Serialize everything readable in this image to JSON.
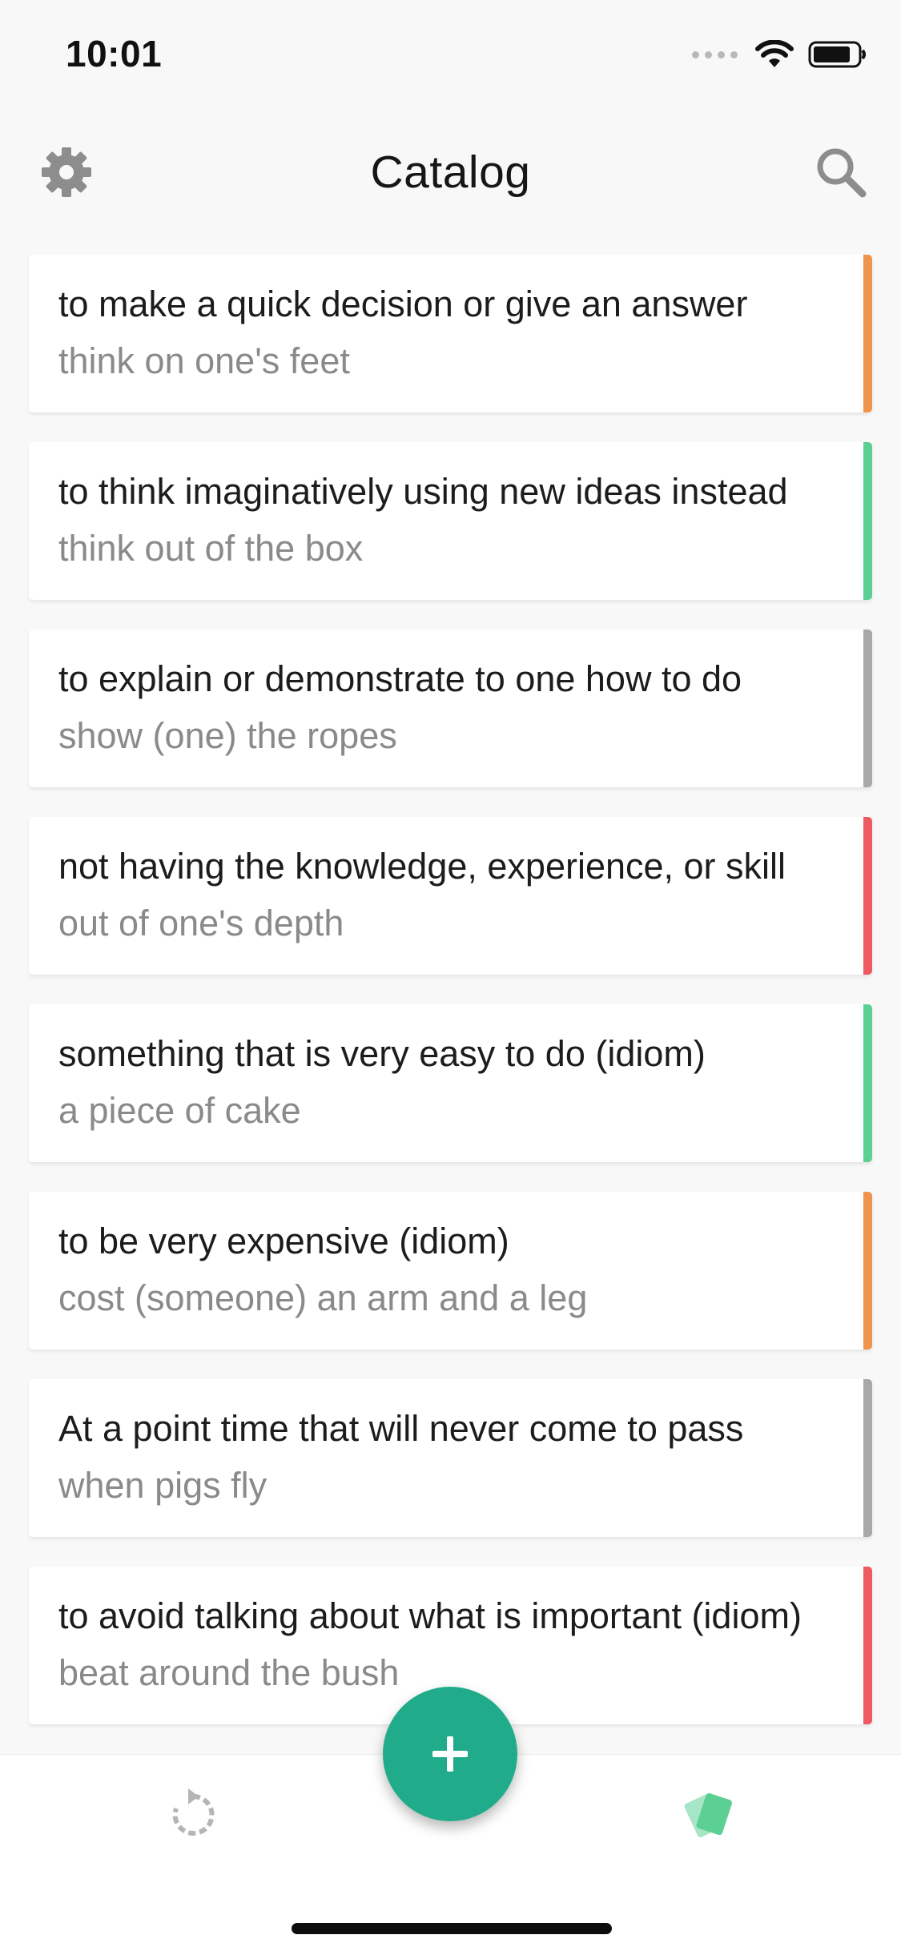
{
  "status_bar": {
    "time": "10:01"
  },
  "header": {
    "title": "Catalog",
    "settings_icon": "gear-icon",
    "search_icon": "search-icon"
  },
  "cards": [
    {
      "definition": "to make a quick decision or give an answer",
      "phrase": "think on one's feet",
      "accent": "#f0934d"
    },
    {
      "definition": "to think imaginatively using new ideas instead",
      "phrase": "think out of the box",
      "accent": "#5ccf93"
    },
    {
      "definition": "to explain or demonstrate to one how to do",
      "phrase": "show (one) the ropes",
      "accent": "#a8a8a8"
    },
    {
      "definition": "not having the knowledge, experience, or skill",
      "phrase": "out of one's depth",
      "accent": "#ee5a63"
    },
    {
      "definition": "something that is very easy to do (idiom)",
      "phrase": "a piece of cake",
      "accent": "#5ccf93"
    },
    {
      "definition": "to be very expensive (idiom)",
      "phrase": "cost (someone) an arm and a leg",
      "accent": "#f0934d"
    },
    {
      "definition": "At a point time that will never come to pass",
      "phrase": "when pigs fly",
      "accent": "#a8a8a8"
    },
    {
      "definition": "to avoid talking about what is important (idiom)",
      "phrase": "beat around the bush",
      "accent": "#ee5a63"
    }
  ],
  "tab_bar": {
    "review_icon": "review-icon",
    "catalog_icon": "cards-icon",
    "add_icon": "plus-icon"
  },
  "colors": {
    "accent": "#20ab8a",
    "cards_icon": "#5ccf93"
  }
}
